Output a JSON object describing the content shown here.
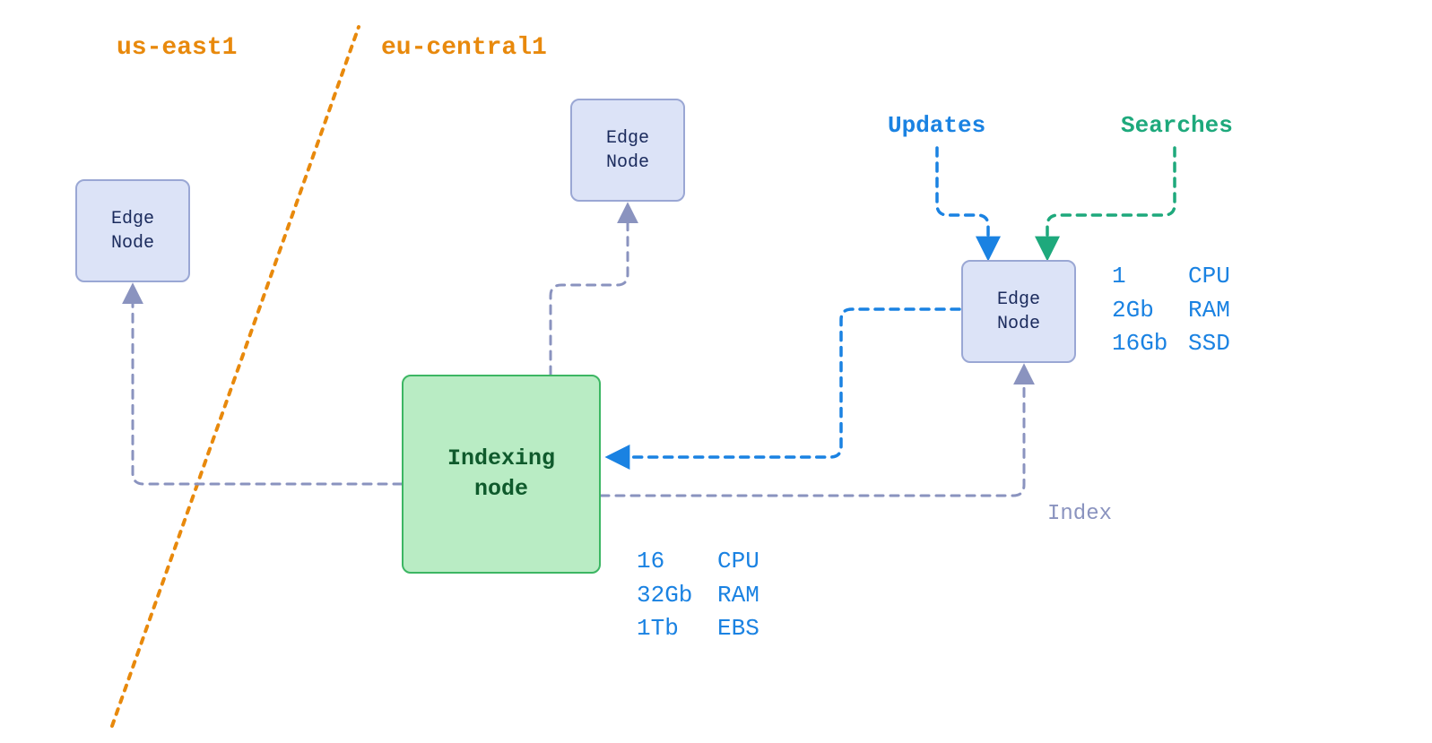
{
  "regions": {
    "left": "us-east1",
    "right": "eu-central1"
  },
  "nodes": {
    "edge_left": {
      "line1": "Edge",
      "line2": "Node"
    },
    "edge_top": {
      "line1": "Edge",
      "line2": "Node"
    },
    "edge_right": {
      "line1": "Edge",
      "line2": "Node"
    },
    "indexing": {
      "line1": "Indexing",
      "line2": "node"
    }
  },
  "flows": {
    "updates": "Updates",
    "searches": "Searches",
    "index": "Index"
  },
  "specs": {
    "indexing": {
      "cpu_v": "16",
      "cpu_l": "CPU",
      "ram_v": "32Gb",
      "ram_l": "RAM",
      "disk_v": "1Tb",
      "disk_l": "EBS"
    },
    "edge": {
      "cpu_v": "1",
      "cpu_l": "CPU",
      "ram_v": "2Gb",
      "ram_l": "RAM",
      "disk_v": "16Gb",
      "disk_l": "SSD"
    }
  },
  "colors": {
    "orange": "#e8890c",
    "blue": "#1a82e2",
    "green": "#1ea97c",
    "slate": "#8a93bf",
    "edge_fill": "#dce3f7",
    "edge_stroke": "#9aa7d4",
    "idx_fill": "#b9ecc4",
    "idx_stroke": "#3cb663"
  }
}
